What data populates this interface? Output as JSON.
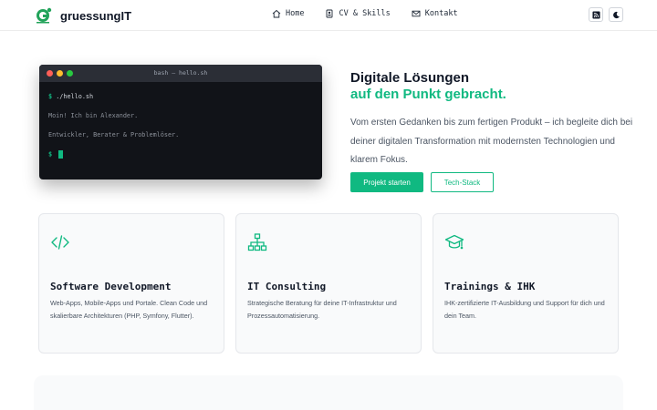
{
  "header": {
    "brand": "gruessungIT",
    "logo_icon": "gruessungIT-logo",
    "nav": [
      {
        "label": "Home",
        "icon": "house-icon"
      },
      {
        "label": "CV & Skills",
        "icon": "id-badge-icon"
      },
      {
        "label": "Kontakt",
        "icon": "envelope-icon"
      }
    ],
    "actions": [
      {
        "icon": "rss-icon"
      },
      {
        "icon": "moon-icon"
      }
    ]
  },
  "terminal": {
    "title": "bash — hello.sh",
    "lines": [
      {
        "prompt": "$",
        "text": "./hello.sh"
      },
      {
        "text": "Moin! Ich bin Alexander."
      },
      {
        "text": "Entwickler, Berater & Problemlöser."
      },
      {
        "prompt": "$",
        "text": ""
      }
    ]
  },
  "hero": {
    "title_line1": "Digitale Lösungen",
    "title_line2": "auf den Punkt gebracht.",
    "text": "Vom ersten Gedanken bis zum fertigen Produkt – ich begleite dich bei deiner digitalen Transformation mit modernsten Technologien und klarem Fokus.",
    "primary_button": "Projekt starten",
    "secondary_button": "Tech-Stack"
  },
  "cards": [
    {
      "icon": "code-icon",
      "title": "Software Development",
      "text": "Web-Apps, Mobile-Apps und Portale. Clean Code und skalierbare Architekturen (PHP, Symfony, Flutter)."
    },
    {
      "icon": "network-icon",
      "title": "IT Consulting",
      "text": "Strategische Beratung für deine IT-Infrastruktur und Prozessautomatisierung."
    },
    {
      "icon": "graduation-cap-icon",
      "title": "Trainings & IHK",
      "text": "IHK-zertifizierte IT-Ausbildung und Support für dich und dein Team."
    }
  ],
  "colors": {
    "accent": "#10b981",
    "terminal_bg": "#111318",
    "dot_red": "#ff5f57",
    "dot_yellow": "#febc2e",
    "dot_green": "#28c840"
  }
}
